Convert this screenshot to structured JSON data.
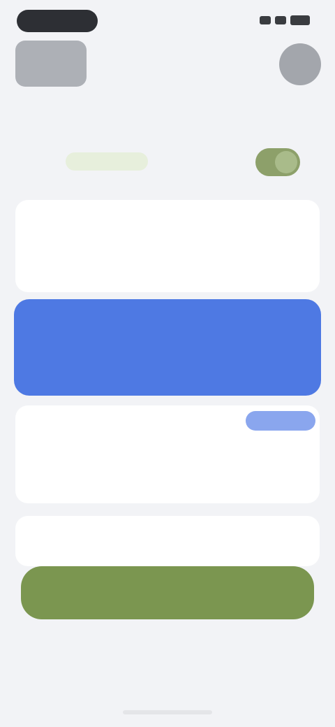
{
  "status_bar": {
    "time": ""
  },
  "header": {
    "title": ""
  },
  "toggle": {
    "left_label": "",
    "right_label": "",
    "state": "on"
  },
  "cards": [
    {
      "title": "",
      "subtitle": "",
      "amount": "",
      "amount_suffix": ""
    },
    {
      "title": "",
      "subtitle": "",
      "amount": "",
      "amount_suffix": "",
      "badge": ""
    },
    {
      "title": ""
    }
  ],
  "highlight_card": {
    "top_label": "",
    "mid_label": "",
    "right_top": "",
    "right_bottom": ""
  },
  "cta": {
    "label": "",
    "note": ""
  },
  "footer": {
    "text": ""
  },
  "colors": {
    "accent_green": "#7b9650",
    "accent_blue": "#4e79e3",
    "background": "#f2f3f6"
  }
}
